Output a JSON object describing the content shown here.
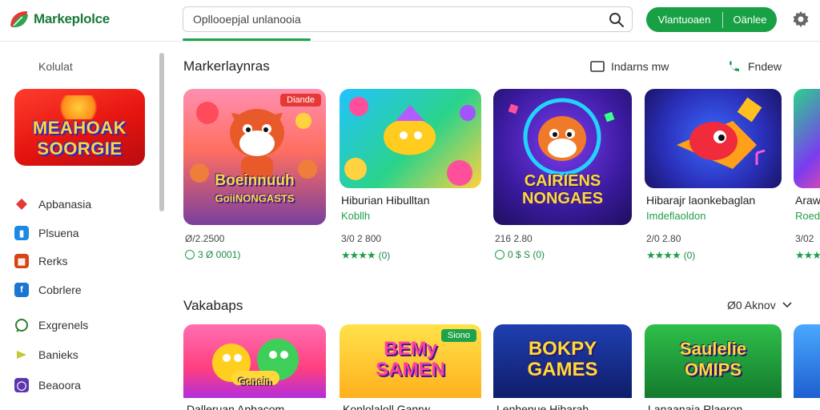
{
  "app": {
    "name": "Markeplolce",
    "brand_color": "#1b7a3b"
  },
  "search": {
    "value": "Opllooepjal unlanooia",
    "icon": "search-icon"
  },
  "header": {
    "button_left": "Vlantuoaen",
    "button_right": "Oänlee",
    "button_color": "#17a044",
    "settings_icon": "gear-icon"
  },
  "sidebar": {
    "label": "Kolulat",
    "featured_title_line1": "MEAHOAK",
    "featured_title_line2": "SOORGIE",
    "items": [
      {
        "label": "Apbanasia",
        "icon": "diamond-icon",
        "color": "#e53935"
      },
      {
        "label": "Plsuena",
        "icon": "bookmark-icon",
        "color": "#1e88e5"
      },
      {
        "label": "Rerks",
        "icon": "puzzle-icon",
        "color": "#d84315"
      },
      {
        "label": "Cobrlere",
        "icon": "facebook-icon",
        "color": "#1976d2"
      },
      {
        "label": "Exgrenels",
        "icon": "chat-icon",
        "color": "#2e7d32"
      },
      {
        "label": "Banieks",
        "icon": "gamepad-icon",
        "color": "#c0ca33"
      },
      {
        "label": "Beaoora",
        "icon": "circle-icon",
        "color": "#5e35b1"
      }
    ]
  },
  "section1": {
    "title": "Markerlaynras",
    "link1": "Indarns mw",
    "link2": "Fndew",
    "cards": [
      {
        "badge": "Diande",
        "art_line1": "Boeinnuuh",
        "art_line2": "GoiiNONGASTS",
        "name": "",
        "sub": "",
        "meta": "Ø/2.2500",
        "rating": "3 Ø 0001)",
        "rating_style": "circle"
      },
      {
        "badge": "",
        "art_line1": "",
        "art_line2": "",
        "name": "Hiburian Hibulltan",
        "sub": "Kobllh",
        "meta": "3/0 2 800",
        "rating": "(0)",
        "rating_style": "stars"
      },
      {
        "badge": "",
        "art_line1": "CAIRIENS",
        "art_line2": "NONGAES",
        "name": "",
        "sub": "",
        "meta": "216 2.80",
        "rating": "0 $ S (0)",
        "rating_style": "circle"
      },
      {
        "badge": "",
        "art_line1": "",
        "art_line2": "",
        "name": "Hibarajr laonkebaglan",
        "sub": "Imdeflaoldon",
        "meta": "2/0 2.80",
        "rating": "(0)",
        "rating_style": "stars"
      },
      {
        "badge": "",
        "art_line1": "",
        "art_line2": "",
        "name": "Arawl",
        "sub": "Roedl",
        "meta": "3/02",
        "rating": "",
        "rating_style": "stars"
      }
    ]
  },
  "section2": {
    "title": "Vakabaps",
    "link": "Ø0 Aknov",
    "cards": [
      {
        "badge": "",
        "art_line1": "",
        "art_line2": "Gonein",
        "name": "Dalleruan Apbacom"
      },
      {
        "badge": "Siono",
        "art_line1": "BEMy",
        "art_line2": "SAMEN",
        "name": "Konlolaloll Ganrw"
      },
      {
        "badge": "",
        "art_line1": "BOKPY",
        "art_line2": "GAMES",
        "name": "Lenhenue Hibarah"
      },
      {
        "badge": "",
        "art_line1": "Saulelie",
        "art_line2": "OMIPS",
        "name": "Lanaanaia Rlaeron"
      },
      {
        "badge": "",
        "art_line1": "",
        "art_line2": "",
        "name": ""
      }
    ]
  }
}
